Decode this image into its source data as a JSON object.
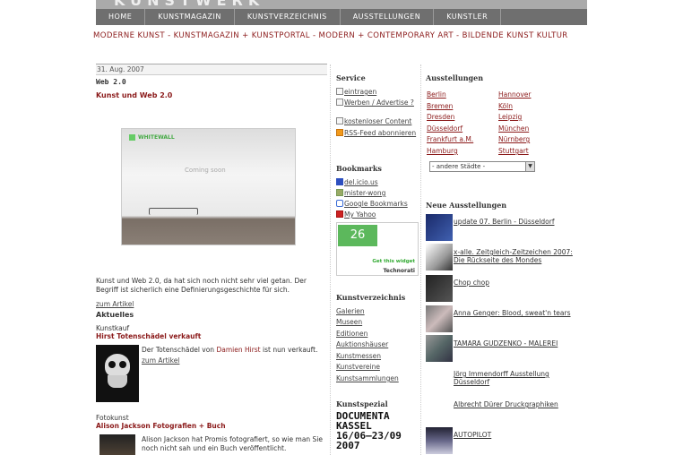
{
  "nav": {
    "items": [
      "HOME",
      "KUNSTMAGAZIN",
      "KUNSTVERZEICHNIS",
      "AUSSTELLUNGEN",
      "KUNSTLER"
    ]
  },
  "tagline": "MODERNE KUNST - KUNSTMAGAZIN + KUNSTPORTAL - MODERN + CONTEMPORARY ART - BILDENDE KUNST KULTUR",
  "post": {
    "date": "31. Aug. 2007",
    "title": "Web 2.0",
    "subtitle": "Kunst und Web 2.0",
    "image_brand": "WHITEWALL",
    "image_caption": "Coming soon",
    "text": "Kunst und Web 2.0, da hat sich noch nicht sehr viel getan. Der Begriff ist sicherlich eine Definierungsgeschichte für sich.",
    "more": "zum Artikel"
  },
  "aktuelles": {
    "title": "Aktuelles",
    "items": [
      {
        "category": "Kunstkauf",
        "title": "Hirst Totenschädel verkauft",
        "text_pre": "Der Totenschädel von ",
        "text_name": "Damien Hirst",
        "text_post": " ist nun verkauft.",
        "more": "zum Artikel"
      },
      {
        "category": "Fotokunst",
        "title": "Alison Jackson Fotografien + Buch",
        "text": "Alison Jackson hat Promis fotografiert, so wie man Sie noch nicht sah und ein Buch veröffentlicht."
      }
    ]
  },
  "service": {
    "title": "Service",
    "items": [
      "eintragen",
      "Werben / Advertise ?",
      "kostenloser Content",
      "RSS-Feed abonnieren"
    ]
  },
  "bookmarks": {
    "title": "Bookmarks",
    "items": [
      "del.icio.us",
      "mister-wong",
      "Google Bookmarks",
      "My Yahoo"
    ]
  },
  "technorati": {
    "count": "26",
    "cta": "Get this widget",
    "brand": "Technorati"
  },
  "kunstverzeichnis": {
    "title": "Kunstverzeichnis",
    "items": [
      "Galerien",
      "Museen",
      "Editionen",
      "Auktionshäuser",
      "Kunstmessen",
      "Kunstvereine",
      "Kunstsammlungen"
    ]
  },
  "kunstspezial": {
    "title": "Kunstspezial",
    "line1": "DOCUMENTA",
    "line2": "KASSEL",
    "line3": "16/06—23/09",
    "line4": "2007"
  },
  "ausstellungen": {
    "title": "Ausstellungen",
    "cities_left": [
      "Berlin",
      "Bremen",
      "Dresden",
      "Düsseldorf",
      "Frankfurt a.M.",
      "Hamburg"
    ],
    "cities_right": [
      "Hannover",
      "Köln",
      "Leipzig",
      "München",
      "Nürnberg",
      "Stuttgart"
    ],
    "select": "- andere Städte -"
  },
  "neue": {
    "title": "Neue Ausstellungen",
    "items": [
      "update 07. Berlin - Düsseldorf",
      "x-alle. Zeitgleich-Zeitzeichen 2007: Die Rückseite des Mondes",
      "Chop chop",
      "Anna Genger: Blood, sweat'n tears",
      "TAMARA GUDZENKO - MALEREI",
      "Jörg Immendorff Ausstellung Düsseldorf",
      "Albrecht Dürer Druckgraphiken",
      "AUTOPILOT"
    ]
  },
  "colors": {
    "accent": "#8b1a1a",
    "nav_bg": "#6f6f6f"
  }
}
